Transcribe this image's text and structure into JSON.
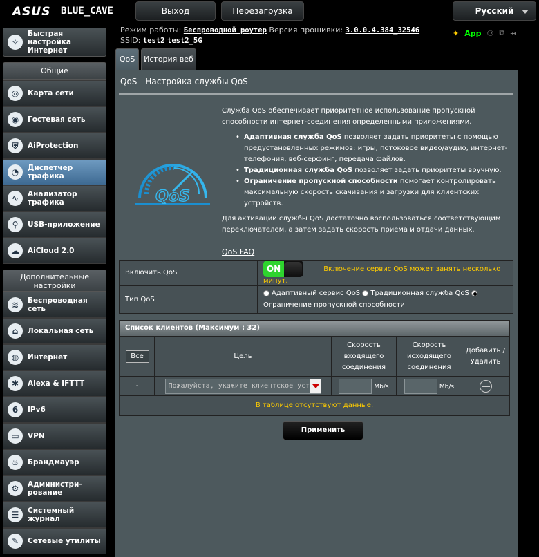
{
  "header": {
    "brand": "ASUS",
    "model": "BLUE_CAVE",
    "logout_label": "Выход",
    "reboot_label": "Перезагрузка",
    "language_label": "Русский"
  },
  "info": {
    "mode_label": "Режим работы:",
    "mode_value": "Беспроводной роутер",
    "firmware_label": "Версия прошивки:",
    "firmware_value": "3.0.0.4.384_32546",
    "ssid_label": "SSID:",
    "ssid_1": "test2",
    "ssid_2": "test2_5G",
    "app_label": "App"
  },
  "sidebar": {
    "quick_setup": "Быстрая настройка Интернет",
    "general_head": "Общие",
    "general": [
      {
        "label": "Карта сети",
        "icon": "network-map-icon",
        "glyph": "◎"
      },
      {
        "label": "Гостевая сеть",
        "icon": "guest-network-icon",
        "glyph": "◉"
      },
      {
        "label": "AiProtection",
        "icon": "aiprotection-icon",
        "glyph": "⛨"
      },
      {
        "label": "Диспетчер трафика",
        "icon": "traffic-manager-icon",
        "glyph": "◔"
      },
      {
        "label": "Анализатор трафика",
        "icon": "traffic-analyzer-icon",
        "glyph": "∿"
      },
      {
        "label": "USB-приложение",
        "icon": "usb-app-icon",
        "glyph": "⚲"
      },
      {
        "label": "AiCloud 2.0",
        "icon": "aicloud-icon",
        "glyph": "☁"
      }
    ],
    "advanced_head": "Дополнительные настройки",
    "advanced": [
      {
        "label": "Беспроводная сеть",
        "icon": "wireless-icon",
        "glyph": "≋"
      },
      {
        "label": "Локальная сеть",
        "icon": "lan-icon",
        "glyph": "⌂"
      },
      {
        "label": "Интернет",
        "icon": "globe-icon",
        "glyph": "◍"
      },
      {
        "label": "Alexa & IFTTT",
        "icon": "alexa-icon",
        "glyph": "✱"
      },
      {
        "label": "IPv6",
        "icon": "ipv6-icon",
        "glyph": "6"
      },
      {
        "label": "VPN",
        "icon": "vpn-icon",
        "glyph": "▭"
      },
      {
        "label": "Брандмауэр",
        "icon": "firewall-icon",
        "glyph": "♨"
      },
      {
        "label": "Администри-рование",
        "icon": "admin-icon",
        "glyph": "⚙"
      },
      {
        "label": "Системный журнал",
        "icon": "syslog-icon",
        "glyph": "☰"
      },
      {
        "label": "Сетевые утилиты",
        "icon": "network-tools-icon",
        "glyph": "✎"
      }
    ]
  },
  "tabs": {
    "qos": "QoS",
    "history": "История веб"
  },
  "page": {
    "title": "QoS - Настройка службы QoS",
    "intro": "Служба QoS обеспечивает приоритетное использование пропускной способности интернет-соединения определенными приложениями.",
    "b1_title": "Адаптивная служба QoS",
    "b1_text": " позволяет задать приоритеты с помощью предустановленных режимов: игры, потоковое видео/аудио, интернет-телефония, веб-серфинг, передача файлов.",
    "b2_title": "Традиционная служба QoS",
    "b2_text": " позволяет задать приоритеты вручную.",
    "b3_title": "Ограничение пропускной способности",
    "b3_text": " помогает контролировать максимальную скорость скачивания и загрузки для клиентских устройств.",
    "activation": "Для активации службы QoS достаточно воспользоваться соответствующим переключателем, а затем задать скорость приема и отдачи данных.",
    "faq": "QoS FAQ",
    "gauge_text": "QoS"
  },
  "settings": {
    "enable_label": "Включить QoS",
    "toggle_on": "ON",
    "enable_note": "Включение сервис QoS может занять несколько минут.",
    "type_label": "Тип QoS",
    "opt_adaptive": "Адаптивный сервис QoS",
    "opt_traditional": "Традиционная служба QoS",
    "opt_limit": "Ограничение пропускной способности"
  },
  "clients": {
    "head": "Список клиентов (Максимум : 32)",
    "col_all": "Все",
    "col_target": "Цель",
    "col_down": "Скорость входящего соединения",
    "col_up": "Скорость исходящего соединения",
    "col_action": "Добавить / Удалить",
    "row_dash": "-",
    "placeholder": "Пожалуйста, укажите клиентское устройство",
    "unit": "Mb/s",
    "no_data": "В таблице отсутствуют данные."
  },
  "apply_label": "Применить",
  "colors": {
    "panel": "#4d595d",
    "toggle_on": "#2ed42e",
    "warning": "#ffcc00",
    "active_nav": "#4f7ea8"
  }
}
